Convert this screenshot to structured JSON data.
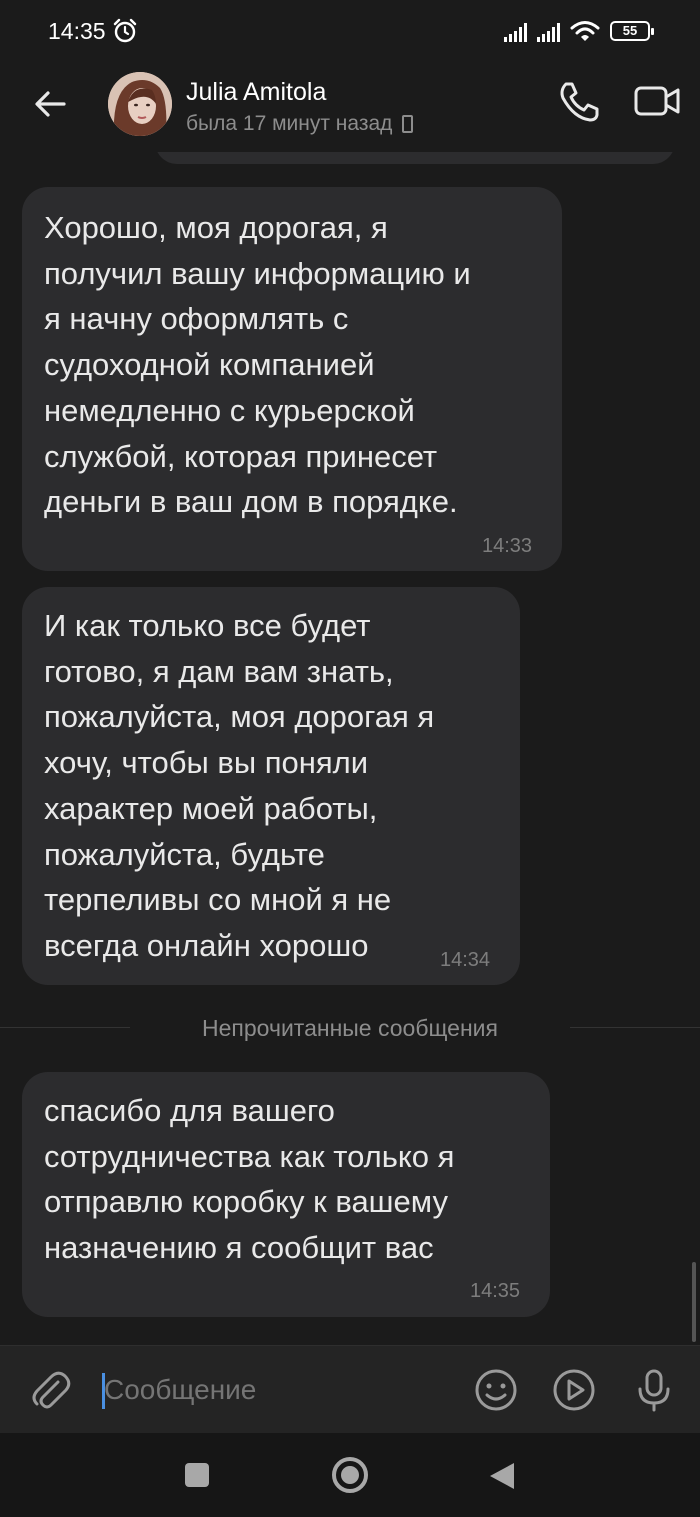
{
  "status_bar": {
    "time": "14:35",
    "battery": "55",
    "icons": [
      "alarm-icon",
      "signal-icon",
      "signal-icon",
      "wifi-icon",
      "battery-icon"
    ]
  },
  "header": {
    "contact_name": "Julia Amitola",
    "last_seen": "была 17 минут назад",
    "icons": [
      "back-arrow-icon",
      "phone-icon",
      "video-camera-icon",
      "mobile-device-icon"
    ]
  },
  "messages": [
    {
      "text": "Хорошо, моя дорогая, я\nполучил вашу информацию и\nя начну оформлять с\nсудоходной компанией\nнемедленно с курьерской\nслужбой, которая принесет\nденьги в ваш дом в порядке.",
      "time": "14:33"
    },
    {
      "text": "И как только все будет\nготово, я дам вам знать,\nпожалуйста, моя дорогая я\nхочу, чтобы вы поняли\nхарактер моей работы,\nпожалуйста, будьте\nтерпеливы со мной я не\nвсегда онлайн хорошо",
      "time": "14:34"
    },
    {
      "text": "спасибо для вашего\nсотрудничества как только я\nотправлю коробку к вашему\nназначению я сообщит вас",
      "time": "14:35"
    }
  ],
  "unread_divider": "Непрочитанные сообщения",
  "composer": {
    "placeholder": "Сообщение",
    "icons": [
      "paperclip-icon",
      "emoji-icon",
      "play-circle-icon",
      "microphone-icon"
    ]
  },
  "nav_bar": {
    "icons": [
      "recents-square-icon",
      "home-circle-icon",
      "back-triangle-icon"
    ]
  },
  "colors": {
    "background": "#1b1b1b",
    "bubble": "#2c2c2e",
    "text": "#e9e9e9",
    "muted": "#8d8d8d",
    "cursor_accent": "#4a90e2"
  }
}
